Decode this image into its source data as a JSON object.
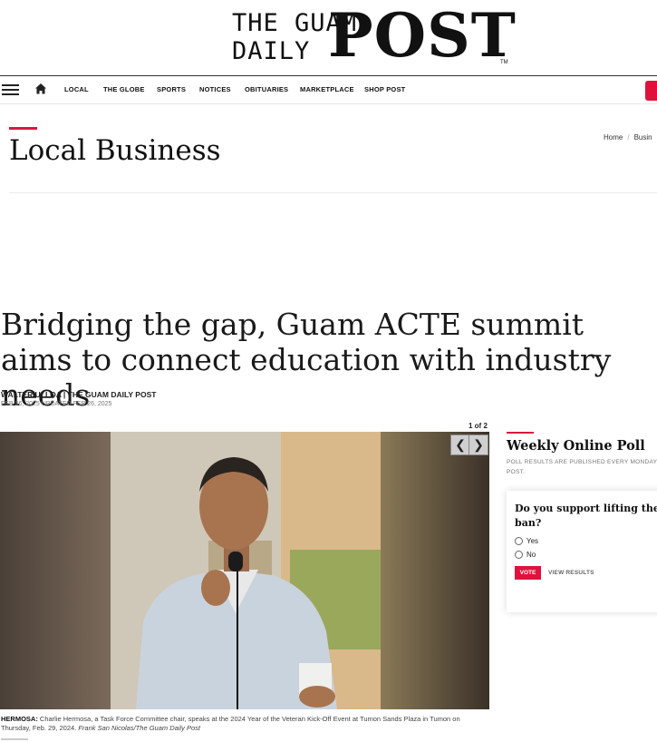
{
  "masthead": {
    "line1": "THE GUAM",
    "line2": "DAILY",
    "big": "POST",
    "tm": "TM"
  },
  "nav": {
    "items": [
      "LOCAL",
      "THE GLOBE",
      "SPORTS",
      "NOTICES",
      "OBITUARIES",
      "MARKETPLACE",
      "SHOP POST"
    ],
    "accent": "#e0123c"
  },
  "section": {
    "title": "Local Business"
  },
  "breadcrumb": {
    "home": "Home",
    "current": "Busin"
  },
  "article": {
    "headline": "Bridging the gap, Guam ACTE summit aims to connect education with industry needs",
    "byline": "WALTER ULLOA | THE GUAM DAILY POST",
    "dates": "FEB 26, 2025 UPDATED FEB 26, 2025",
    "counter": "1 of 2",
    "caption_lead": "HERMOSA:",
    "caption_text": " Charlie Hermosa, a Task Force Committee chair, speaks at the 2024 Year of the Veteran Kick-Off Event at Tumon Sands Plaza in Tumon on Thursday, Feb. 29, 2024. ",
    "caption_credit": "Frank San Nicolas/The Guam Daily Post"
  },
  "poll": {
    "heading": "Weekly Online Poll",
    "note": "POLL RESULTS ARE PUBLISHED EVERY MONDAY POST.",
    "question_line1": "Do you support lifting the fi",
    "question_line2": "ban?",
    "options": [
      "Yes",
      "No"
    ],
    "vote_label": "VOTE",
    "results_label": "VIEW RESULTS"
  },
  "icons": {
    "menu": "hamburger-icon",
    "home": "home-icon",
    "prev": "chevron-left-icon",
    "next": "chevron-right-icon"
  }
}
